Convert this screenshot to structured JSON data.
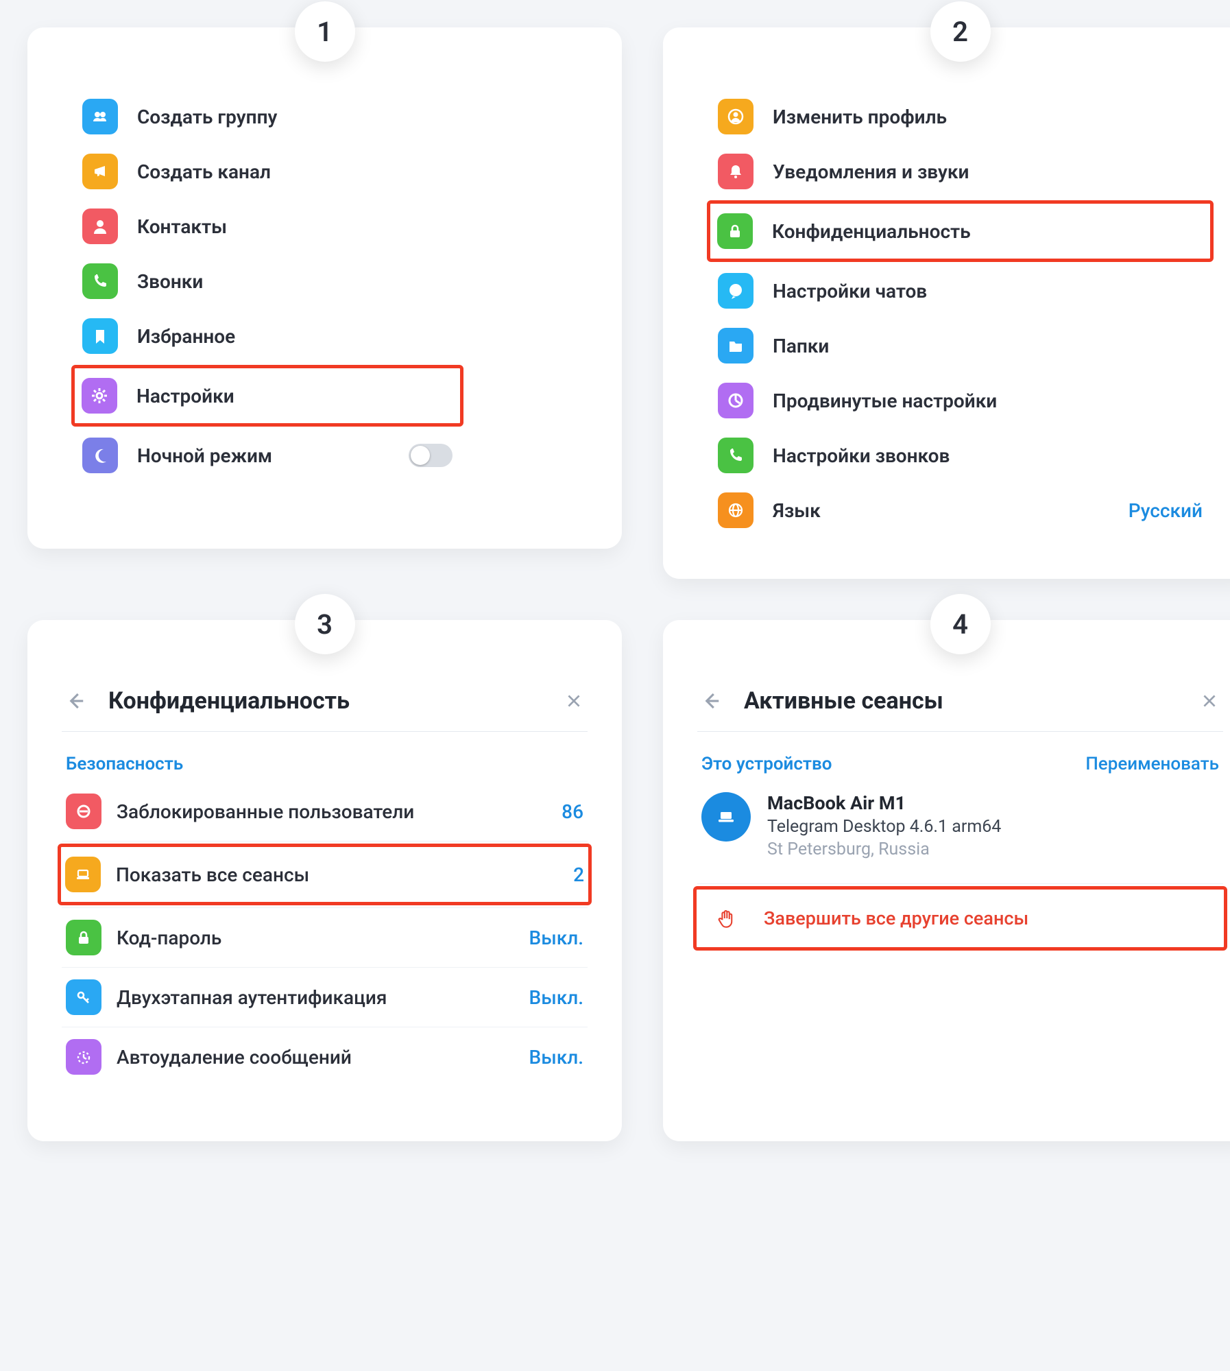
{
  "steps": {
    "s1": "1",
    "s2": "2",
    "s3": "3",
    "s4": "4"
  },
  "panel1": {
    "items": [
      {
        "label": "Создать группу"
      },
      {
        "label": "Создать канал"
      },
      {
        "label": "Контакты"
      },
      {
        "label": "Звонки"
      },
      {
        "label": "Избранное"
      },
      {
        "label": "Настройки"
      },
      {
        "label": "Ночной режим"
      }
    ],
    "highlightIndex": 5,
    "nightModeOn": false
  },
  "panel2": {
    "items": [
      {
        "label": "Изменить профиль"
      },
      {
        "label": "Уведомления и звуки"
      },
      {
        "label": "Конфиденциальность"
      },
      {
        "label": "Настройки чатов"
      },
      {
        "label": "Папки"
      },
      {
        "label": "Продвинутые настройки"
      },
      {
        "label": "Настройки звонков"
      },
      {
        "label": "Язык",
        "value": "Русский"
      }
    ],
    "highlightIndex": 2
  },
  "panel3": {
    "title": "Конфиденциальность",
    "section": "Безопасность",
    "rows": [
      {
        "label": "Заблокированные пользователи",
        "value": "86"
      },
      {
        "label": "Показать все сеансы",
        "value": "2"
      },
      {
        "label": "Код-пароль",
        "value": "Выкл."
      },
      {
        "label": "Двухэтапная аутентификация",
        "value": "Выкл."
      },
      {
        "label": "Автоудаление сообщений",
        "value": "Выкл."
      }
    ],
    "highlightIndex": 1
  },
  "panel4": {
    "title": "Активные сеансы",
    "section": "Это устройство",
    "rename": "Переименовать",
    "device": {
      "name": "MacBook Air M1",
      "client": "Telegram Desktop 4.6.1 arm64",
      "location": "St Petersburg, Russia"
    },
    "terminate": "Завершить все другие сеансы"
  }
}
